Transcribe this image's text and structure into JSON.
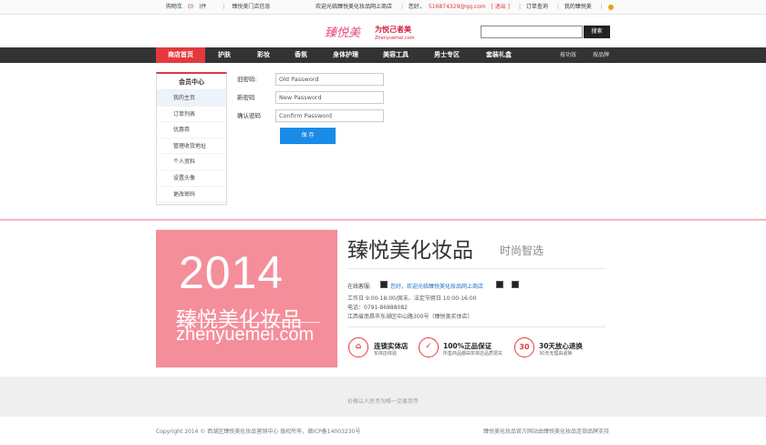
{
  "topbar": {
    "cart": "购物车",
    "cart_count": "0",
    "cart_unit": "件",
    "store_info": "臻悦美门店信息",
    "welcome": "欢迎光临臻悦美化妆品网上商店",
    "greeting": "您好，",
    "email": "516874329@qq.com",
    "logout": "[ 退出 ]",
    "order_query": "订单查询",
    "my_account": "我的臻悦美"
  },
  "header": {
    "logo_text": "臻悦美",
    "slogan": "为悦己者美",
    "domain": "Zhenyuemei.com",
    "search_placeholder": "",
    "search_button": "搜索"
  },
  "nav": {
    "items": [
      "商店首页",
      "护肤",
      "彩妆",
      "香氛",
      "身体护理",
      "美容工具",
      "男士专区",
      "套装礼盒"
    ],
    "right": [
      "按功效",
      "按品牌"
    ]
  },
  "sidebar": {
    "title": "会员中心",
    "items": [
      "我的主页",
      "订单列表",
      "优惠券",
      "管理收货地址",
      "个人资料",
      "设置头像",
      "更改密码"
    ]
  },
  "form": {
    "old_label": "旧密码:",
    "new_label": "新密码",
    "confirm_label": "确认密码",
    "old_placeholder": "Old Password",
    "new_placeholder": "New Password",
    "confirm_placeholder": "Confirm Password",
    "save": "保 存"
  },
  "promo": {
    "year": "2014",
    "cn": "臻悦美化妆品",
    "en": "zhenyuemei.com"
  },
  "brand": {
    "title": "臻悦美化妆品",
    "slogan": "时尚智选",
    "service_label": "在线客服:",
    "service_link": "您好，欢迎光临臻悦美化妆品网上商店",
    "hours": "工作日 9:00-18:00/周末、法定节假日 10:00-16:00",
    "phone": "电话：0791-86888082",
    "address": "江西省南昌市东湖区中山路300号（臻悦美实体店）"
  },
  "badges": [
    {
      "icon": "store-icon",
      "title": "连锁实体店",
      "sub": "实体店体验"
    },
    {
      "icon": "shield-icon",
      "title": "100%正品保证",
      "sub": "所售商品都由实体店品质把关"
    },
    {
      "icon": "30-days-icon",
      "title": "30天放心退换",
      "sub": "30天无理由退换"
    }
  ],
  "footer": {
    "note": "价格以人民币为唯一交易货币",
    "copyright": "Copyright 2014 © 西湖区臻悦美化妆品营销中心 版权所有，赣ICP备14003230号",
    "powered": "臻悦美化妆品官方网站由臻悦美化妆品连锁品牌支持"
  },
  "colors": {
    "accent": "#e4393c",
    "nav_bg": "#333333",
    "promo_bg": "#f58e9b",
    "save_button": "#1a8ce8"
  }
}
